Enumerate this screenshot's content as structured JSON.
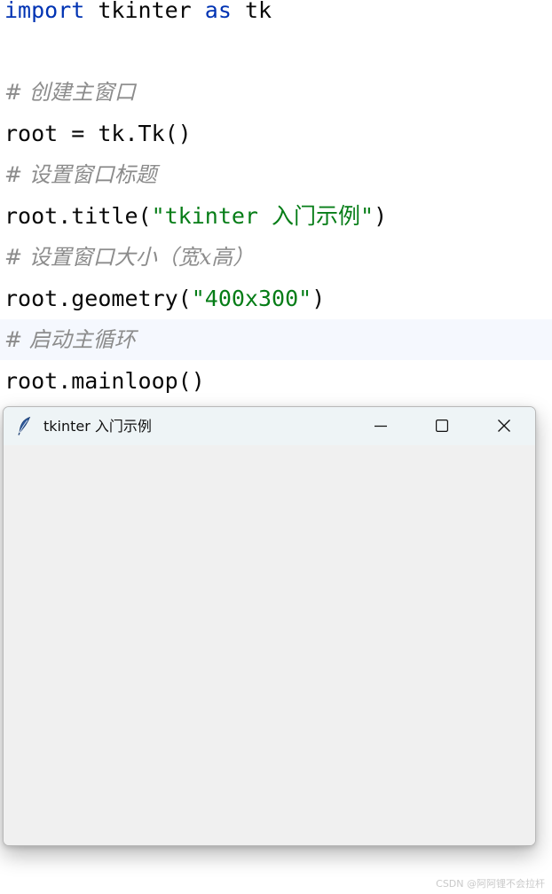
{
  "editor": {
    "lines": [
      {
        "kw1": "import",
        "text": " tkinter ",
        "kw2": "as",
        "text2": " tk"
      },
      {
        "text": ""
      },
      {
        "comment": "# 创建主窗口"
      },
      {
        "text": "root = tk.Tk()"
      },
      {
        "comment": "# 设置窗口标题"
      },
      {
        "pre": "root.title(",
        "str": "\"tkinter 入门示例\"",
        "post": ")"
      },
      {
        "comment": "# 设置窗口大小（宽x高）"
      },
      {
        "pre": "root.geometry(",
        "str": "\"400x300\"",
        "post": ")"
      },
      {
        "comment": "# 启动主循环"
      },
      {
        "text": "root.mainloop()"
      }
    ],
    "colors": {
      "keyword": "#0033b3",
      "string": "#067d17",
      "comment": "#8c8c8c",
      "text": "#080808",
      "current_line": "#f5f8fe"
    }
  },
  "window": {
    "title": "tkinter 入门示例",
    "icon": "feather-icon",
    "controls": [
      "minimize-icon",
      "maximize-icon",
      "close-icon"
    ],
    "titlebar_color": "#eef4f6",
    "client_color": "#f0f0f0"
  },
  "watermark": "CSDN @阿阿锂不会拉杆"
}
